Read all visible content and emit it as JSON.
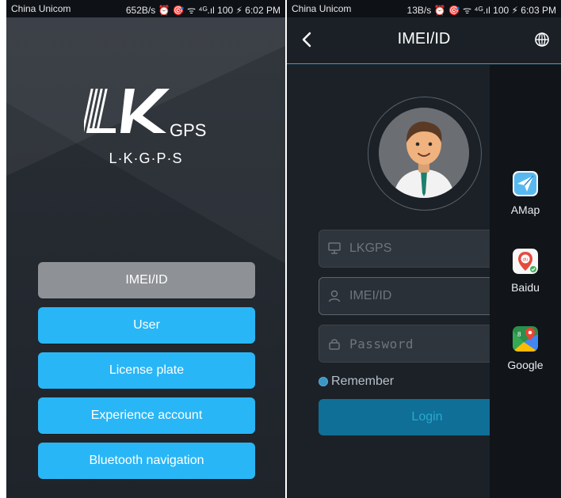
{
  "left": {
    "status_bar": {
      "carrier": "China Unicom",
      "status": "652B/s ⏰ 🎯 ᯤ ⁴ᴳ.ıl 100 ⚡ 6:02 PM"
    },
    "logo": {
      "subtitle": "L·K·G·P·S"
    },
    "menu": [
      {
        "label": "IMEI/ID"
      },
      {
        "label": "User"
      },
      {
        "label": "License plate"
      },
      {
        "label": "Experience account"
      },
      {
        "label": "Bluetooth navigation"
      }
    ],
    "colors": {
      "accent": "#29b6f6",
      "selected": "#8e9196"
    }
  },
  "right": {
    "status_bar": {
      "carrier": "China Unicom",
      "status": "13B/s ⏰ 🎯 ᯤ ⁴ᴳ.ıl 100 ⚡ 6:03 PM"
    },
    "header": {
      "title": "IMEI/ID",
      "back_icon": "chevron-left-icon",
      "globe_icon": "globe-icon"
    },
    "side_menu": [
      {
        "label": "AMap",
        "icon": "amap-icon"
      },
      {
        "label": "Baidu",
        "icon": "baidu-icon"
      },
      {
        "label": "Google",
        "icon": "google-maps-icon"
      }
    ],
    "form": {
      "server": "LKGPS",
      "imei_placeholder": "IMEI/ID",
      "password_placeholder": "Password",
      "remember_label": "Remember",
      "login_label": "Login"
    },
    "colors": {
      "accent": "#2aa3c9"
    }
  }
}
